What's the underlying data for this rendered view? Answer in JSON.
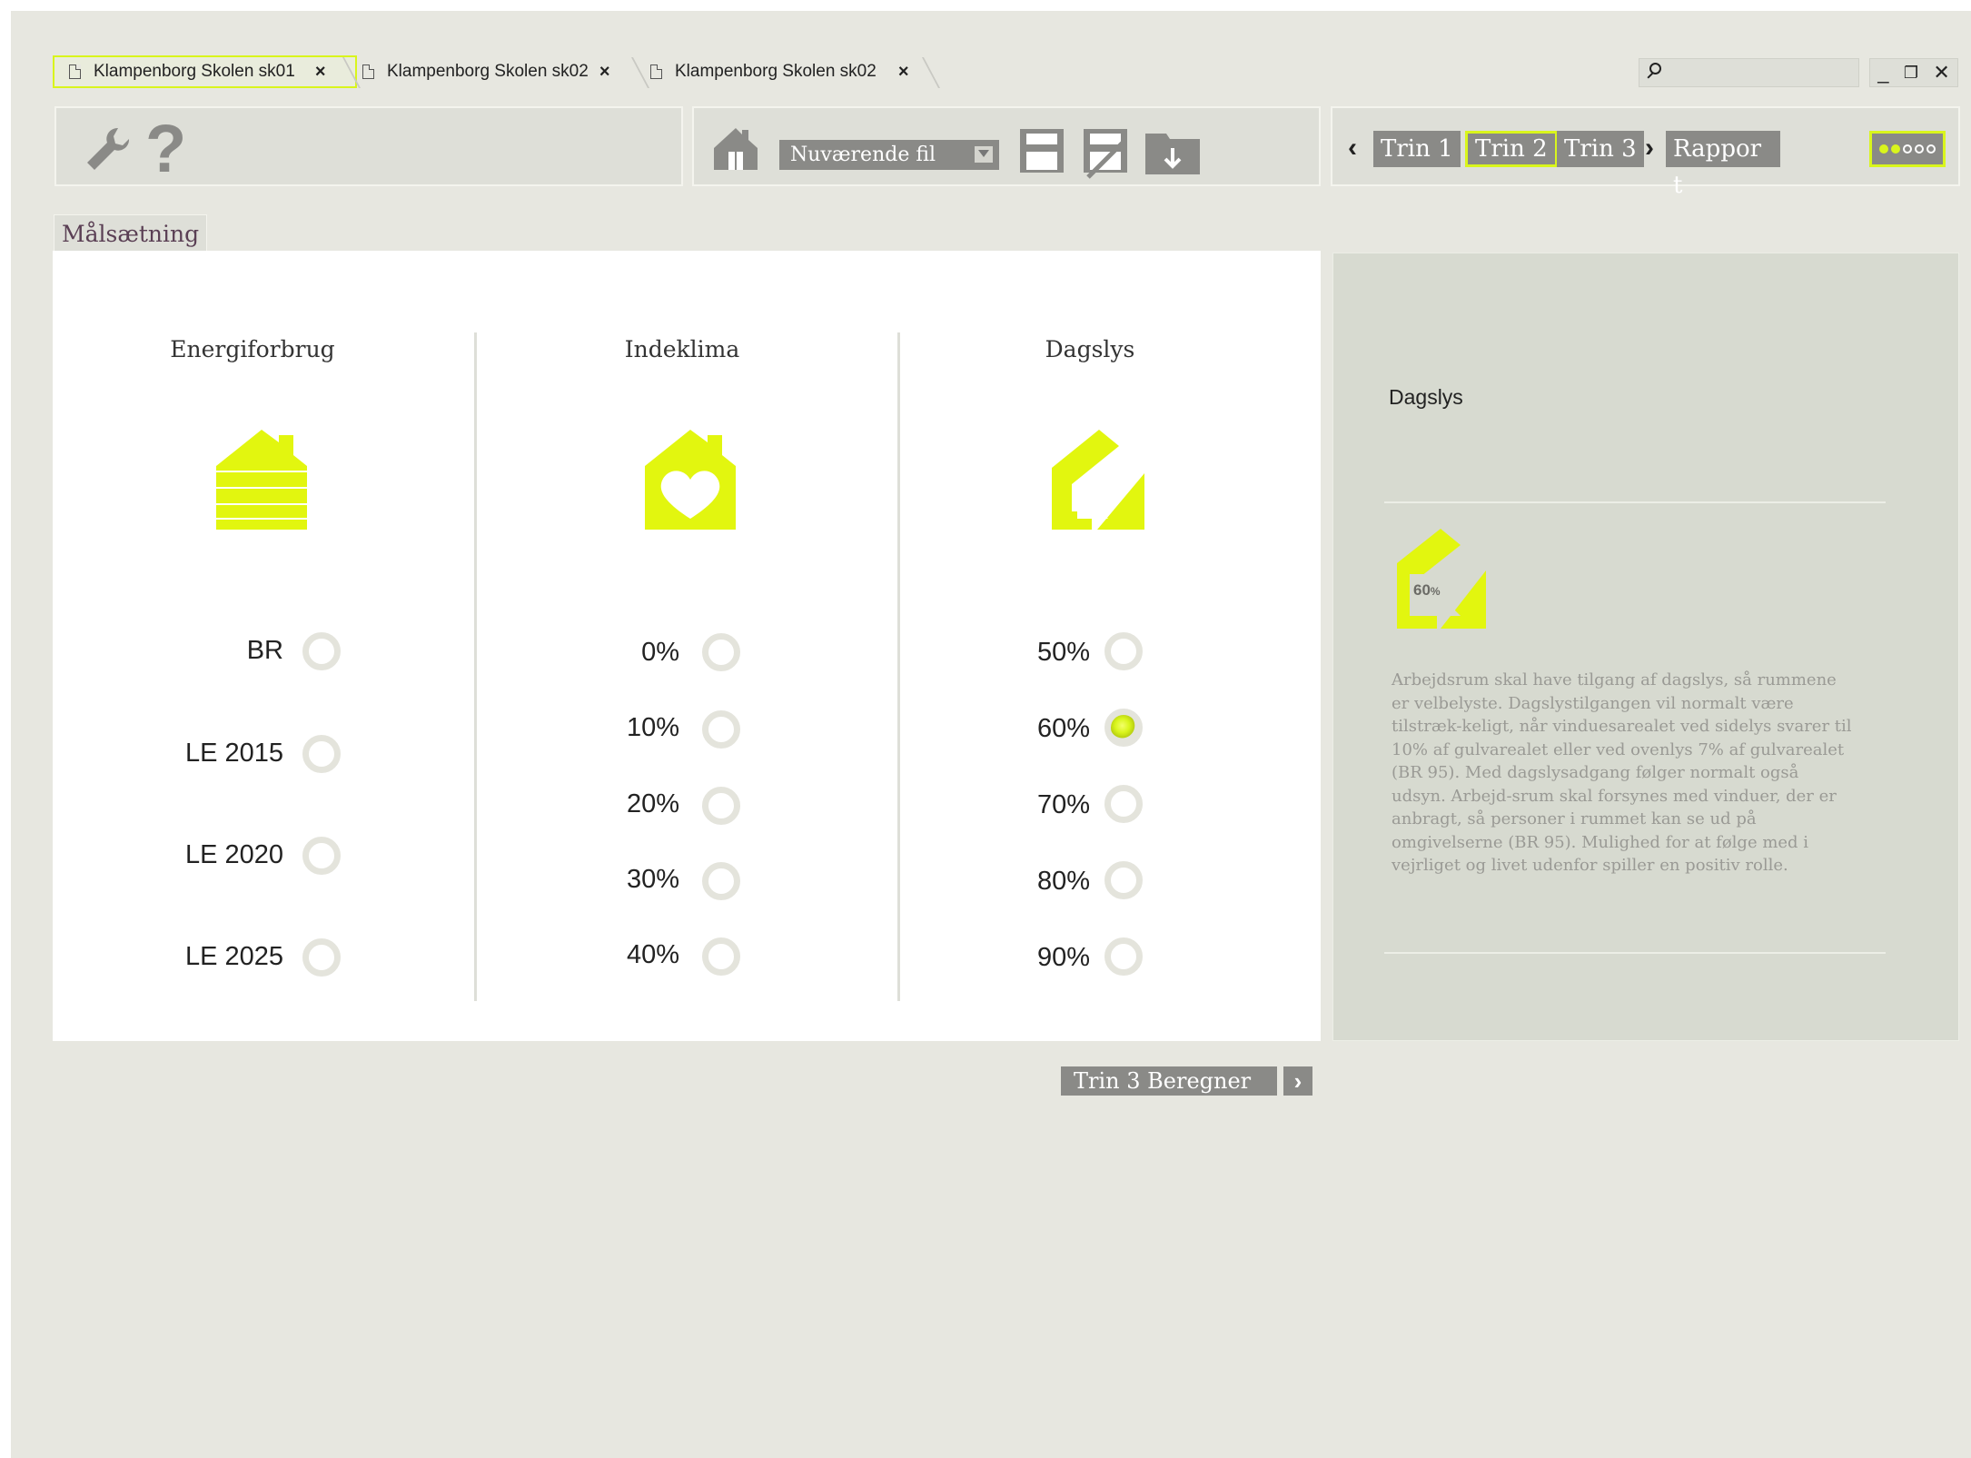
{
  "tabs": [
    {
      "label": "Klampenborg Skolen sk01",
      "close": "×"
    },
    {
      "label": "Klampenborg Skolen sk02",
      "close": "×"
    },
    {
      "label": "Klampenborg Skolen sk02",
      "close": "×"
    }
  ],
  "window_controls": {
    "minimize": "_",
    "restore": "❐",
    "close": "✕"
  },
  "toolbar": {
    "help_glyph": "?",
    "file_select_value": "Nuværende fil",
    "steps": [
      "Trin 1",
      "Trin 2",
      "Trin 3",
      "Rappor t"
    ],
    "prev_chevron": "‹",
    "next_chevron": "›",
    "active_step": "Trin 2"
  },
  "section_label": "Målsætning",
  "columns": [
    {
      "title": "Energiforbrug",
      "icon": "house-layers-icon",
      "options": [
        "BR",
        "LE 2015",
        "LE 2020",
        "LE 2025"
      ],
      "selected": null
    },
    {
      "title": "Indeklima",
      "icon": "house-heart-icon",
      "options": [
        "0%",
        "10%",
        "20%",
        "30%",
        "40%"
      ],
      "selected": null
    },
    {
      "title": "Dagslys",
      "icon": "house-daylight-icon",
      "options": [
        "50%",
        "60%",
        "70%",
        "80%",
        "90%"
      ],
      "selected": "60%"
    }
  ],
  "side_panel": {
    "title": "Dagslys",
    "badge_value": "60",
    "badge_unit": "%",
    "description": "Arbejdsrum skal have tilgang af dagslys, så rummene er velbelyste. Dagslystilgangen vil normalt være tilstræk-keligt, når vinduesarealet ved sidelys svarer til 10% af gulvarealet eller ved ovenlys 7% af gulvarealet (BR 95). Med dagslysadgang følger normalt også udsyn. Arbejd-srum skal forsynes med vinduer, der er anbragt, så personer i rummet kan se ud på omgivelserne (BR 95). Mulighed for at følge med i vejrliget og livet udenfor spiller en positiv rolle."
  },
  "footer": {
    "calc_button": "Trin 3 Beregner",
    "calc_arrow": "›"
  },
  "colors": {
    "accent": "#d9f51c",
    "background": "#e7e7e0",
    "panel": "#dedfd8",
    "button": "#8a8a87",
    "side": "#d7dad0"
  }
}
